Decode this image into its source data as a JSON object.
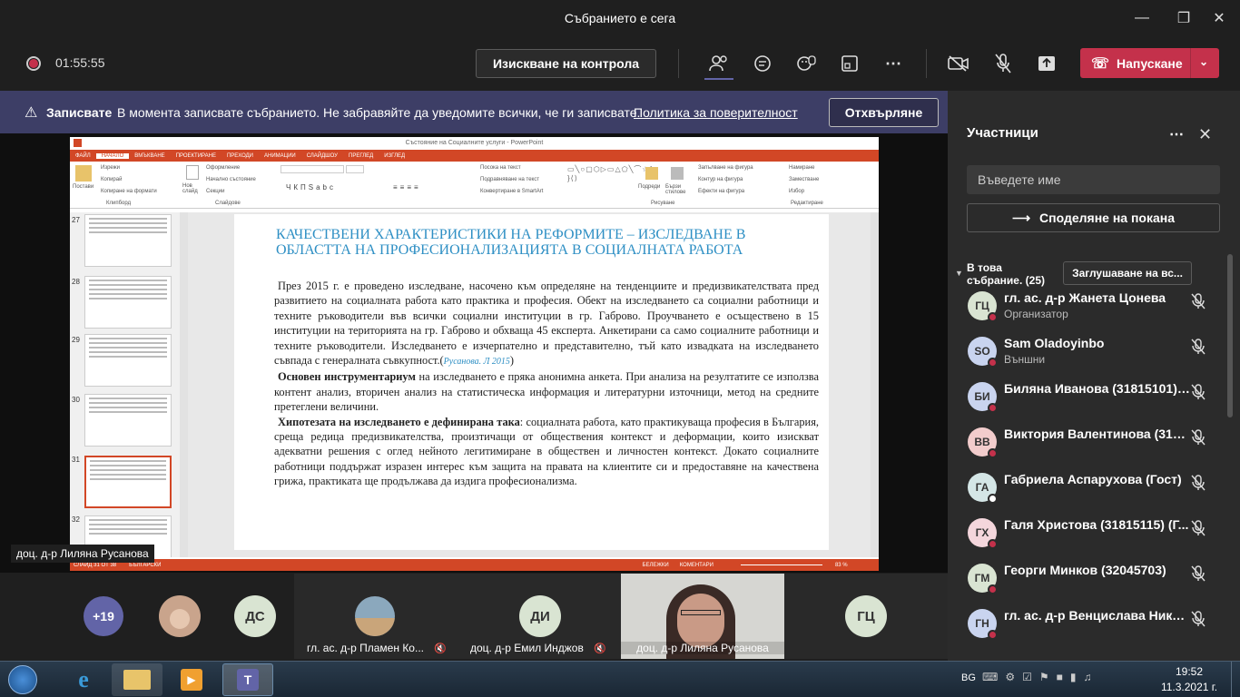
{
  "window": {
    "title": "Събранието е сега"
  },
  "toolbar": {
    "timer": "01:55:55",
    "request_control": "Изискване на контрола",
    "leave": "Напускане"
  },
  "banner": {
    "label": "Записвате",
    "text": "В момента записвате събранието. Не забравяйте да уведомите всички, че ги записвате.",
    "link": "Политика за поверителност",
    "dismiss": "Отхвърляне"
  },
  "ppt": {
    "window_title": "Състояние на Социалните услуги - PowerPoint",
    "tabs": [
      "ФАЙЛ",
      "НАЧАЛО",
      "ВМЪКВАНЕ",
      "ПРОЕКТИРАНЕ",
      "ПРЕХОДИ",
      "АНИМАЦИИ",
      "СЛАЙДШОУ",
      "ПРЕГЛЕД",
      "ИЗГЛЕД"
    ],
    "ribbon": {
      "paste": "Постави",
      "cut": "Изрежи",
      "copy": "Копирай",
      "format_painter": "Копиране на формати",
      "clipboard": "Клипборд",
      "new_slide": "Нов слайд",
      "layout": "Оформление",
      "reset": "Начално състояние",
      "section": "Секции",
      "slides": "Слайдове",
      "shapes": "Фигури",
      "arrange": "Подреди",
      "quick_styles": "Бързи стилове",
      "shape_fill": "Запълване на фигура",
      "shape_outline": "Контур на фигура",
      "shape_effects": "Ефекти на фигура",
      "find": "Намиране",
      "replace": "Заместване",
      "select": "Избор",
      "editing": "Редактиране",
      "drawing": "Рисуване",
      "text_direction": "Посока на текст",
      "align_text": "Подравняване на текст",
      "smartart": "Конвертиране в SmartArt"
    },
    "thumb_numbers": [
      "27",
      "28",
      "29",
      "30",
      "31",
      "32"
    ],
    "slide_title": "КАЧЕСТВЕНИ ХАРАКТЕРИСТИКИ НА РЕФОРМИТЕ – ИЗСЛЕДВАНЕ В ОБЛАСТТА НА ПРОФЕСИОНАЛИЗАЦИЯТА В СОЦИАЛНАТА РАБОТА",
    "p1": "През 2015 г. е проведено изследване, насочено към определяне на тенденциите и предизвикателствата пред развитието на социалната работа като практика и професия.  Обект на изследването са социални работници и техните ръководители във всички социални институции в гр. Габрово. Проучването е осъществено в 15 институции на територията на гр. Габрово и обхваща 45 експерта. Анкетирани са само социалните работници и техните ръководители. Изследването е изчерпателно и представително, тъй като извадката на изследването съвпада с генералната съвкупност.(",
    "p1_cite": "Русанова. Л 2015",
    "p1_end": ")",
    "p2_bold": "Основен инструментариум",
    "p2": " на изследването е пряка анонимна анкета. При анализа на резултатите се използва контент анализ, вторичен анализ на статистическа информация и литературни източници, метод на средните претеглени величини.",
    "p3_bold": "Хипотезата на изследването е дефинирана така",
    "p3": ": социалната работа, като практикуваща професия в България, среща редица предизвикателства, произтичащи от обществения контекст и деформации, които изискват адекватни решения с оглед нейното легитимиране в обществен и личностен контекст. Докато социалните работници поддържат изразен интерес към защита на правата на клиентите си и предоставяне на качествена грижа, практиката ще продължава да издига професионализма.",
    "status_left": "СЛАЙД 31 ОТ 38",
    "status_lang": "БЪЛГАРСКИ",
    "notes": "БЕЛЕЖКИ",
    "comments": "КОМЕНТАРИ",
    "zoom": "83 %"
  },
  "presenter_label": "доц. д-р Лиляна Русанова",
  "gallery": {
    "more": "+19",
    "ds": "ДС",
    "di": "ДИ",
    "gc": "ГЦ",
    "t1": "гл. ас. д-р Пламен Ко...",
    "t2": "доц. д-р Емил Инджов",
    "t3": "доц. д-р Лиляна Русанова"
  },
  "panel": {
    "title": "Участници",
    "search_placeholder": "Въведете име",
    "share": "Споделяне на покана",
    "section": "В това събрание. (25)",
    "mute_all": "Заглушаване на вс...",
    "people": [
      {
        "initials": "ГЦ",
        "name": "гл. ас. д-р Жанета Цонева",
        "role": "Организатор",
        "color": "#d9e4d2",
        "dot": "#c4314b"
      },
      {
        "initials": "SO",
        "name": "Sam Oladoyinbo",
        "role": "Външни",
        "color": "#c9d4ef",
        "dot": "#c4314b"
      },
      {
        "initials": "БИ",
        "name": "Биляна Иванова (31815101) ...",
        "role": "",
        "color": "#c9d4ef",
        "dot": "#c4314b"
      },
      {
        "initials": "ВВ",
        "name": "Виктория Валентинова (318...",
        "role": "",
        "color": "#f2cccc",
        "dot": "#c4314b"
      },
      {
        "initials": "ГА",
        "name": "Габриела Аспарухова (Гост)",
        "role": "",
        "color": "#d4e6e6",
        "dot": "#ffffff"
      },
      {
        "initials": "ГХ",
        "name": "Галя Христова (31815115) (Г...",
        "role": "",
        "color": "#f4d6dc",
        "dot": "#c4314b"
      },
      {
        "initials": "ГМ",
        "name": "Георги Минков (32045703)",
        "role": "",
        "color": "#d9e4d2",
        "dot": "#c4314b"
      },
      {
        "initials": "ГН",
        "name": "гл. ас. д-р Венцислава Нико...",
        "role": "",
        "color": "#c9d4ef",
        "dot": "#c4314b"
      }
    ]
  },
  "taskbar": {
    "lang": "BG",
    "time": "19:52",
    "date": "11.3.2021 г."
  },
  "colors": {
    "accent": "#c4314b",
    "banner": "#3d3e66",
    "ppt": "#d24726",
    "slide_title": "#2e8fc4"
  }
}
